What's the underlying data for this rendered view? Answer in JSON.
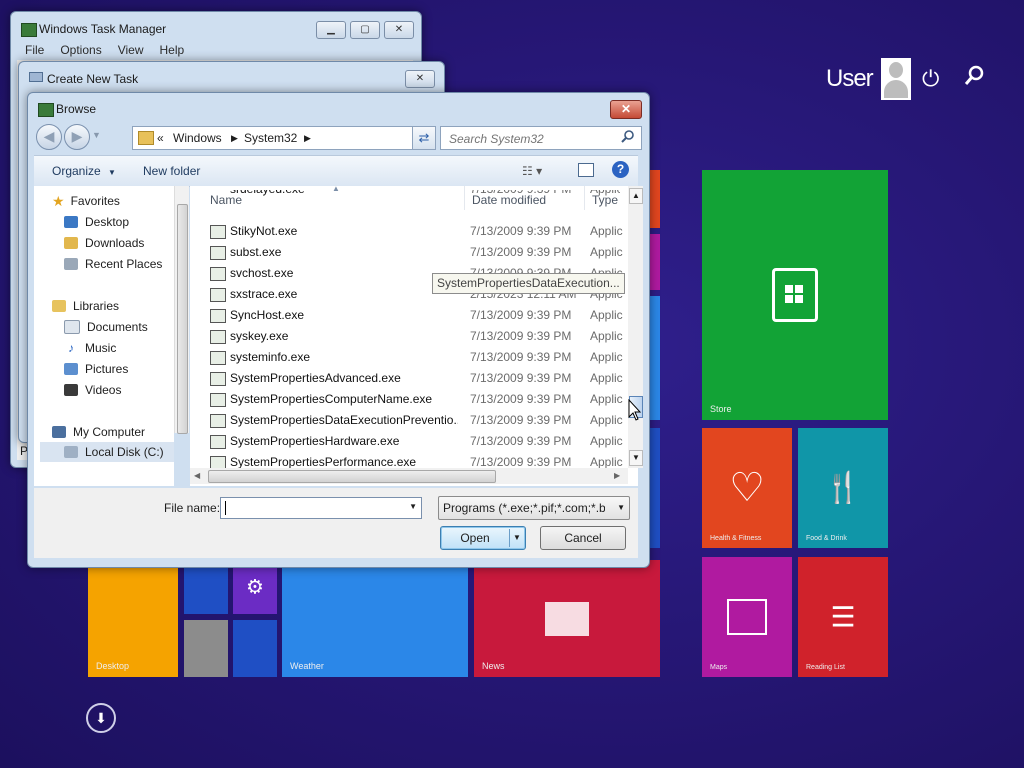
{
  "colors": {
    "desktop": "#241779",
    "tile_green": "#12a336",
    "tile_orange": "#e2461f",
    "tile_teal": "#1096a8",
    "tile_purple": "#b01aa0",
    "tile_red": "#c8193c",
    "tile_crimson": "#d0222b",
    "tile_yellow": "#f5a300",
    "tile_blue": "#2b87e8",
    "tile_small_purple": "#6b2cc4",
    "tile_dark_blue": "#1f4fc4",
    "tile_gray": "#8c8c8c"
  },
  "start_screen": {
    "user_name": "User",
    "icons": [
      "power-icon",
      "search-icon",
      "down-arrow-icon"
    ],
    "tiles": [
      {
        "id": "store",
        "label": "Store",
        "icon": "shopping-bag-icon"
      },
      {
        "id": "health",
        "label": "Health & Fitness",
        "icon": "heart-icon"
      },
      {
        "id": "food",
        "label": "Food & Drink",
        "icon": "fork-knife-icon"
      },
      {
        "id": "maps",
        "label": "Maps",
        "icon": "map-icon"
      },
      {
        "id": "reading",
        "label": "Reading List",
        "icon": "list-icon"
      },
      {
        "id": "news",
        "label": "News",
        "icon": "newspaper-icon"
      },
      {
        "id": "weather",
        "label": "Weather",
        "icon": "weather-icon"
      },
      {
        "id": "desktop",
        "label": "Desktop",
        "icon": "desktop-icon"
      }
    ]
  },
  "task_manager": {
    "title": "Windows Task Manager",
    "menu": [
      "File",
      "Options",
      "View",
      "Help"
    ],
    "side_letter": "P"
  },
  "create_task": {
    "title": "Create New Task"
  },
  "browse": {
    "title": "Browse",
    "address": {
      "prefix": "«",
      "crumbs": [
        "Windows",
        "System32"
      ]
    },
    "search_placeholder": "Search System32",
    "toolbar": {
      "organize": "Organize",
      "new_folder": "New folder"
    },
    "nav": {
      "favorites_header": "Favorites",
      "favorites": [
        "Desktop",
        "Downloads",
        "Recent Places"
      ],
      "libraries_header": "Libraries",
      "libraries": [
        "Documents",
        "Music",
        "Pictures",
        "Videos"
      ],
      "computer_header": "My Computer",
      "computer": [
        "Local Disk (C:)"
      ]
    },
    "columns": {
      "name": "Name",
      "date": "Date modified",
      "type": "Type"
    },
    "files": [
      {
        "name": "srdelayed.exe",
        "date": "7/13/2009 9:39 PM",
        "type": "Applic"
      },
      {
        "name": "StikyNot.exe",
        "date": "7/13/2009 9:39 PM",
        "type": "Applic"
      },
      {
        "name": "subst.exe",
        "date": "7/13/2009 9:39 PM",
        "type": "Applic"
      },
      {
        "name": "svchost.exe",
        "date": "7/13/2009 9:39 PM",
        "type": "Applic"
      },
      {
        "name": "sxstrace.exe",
        "date": "2/15/2023 12:11 AM",
        "type": "Applic"
      },
      {
        "name": "SyncHost.exe",
        "date": "7/13/2009 9:39 PM",
        "type": "Applic"
      },
      {
        "name": "syskey.exe",
        "date": "7/13/2009 9:39 PM",
        "type": "Applic"
      },
      {
        "name": "systeminfo.exe",
        "date": "7/13/2009 9:39 PM",
        "type": "Applic"
      },
      {
        "name": "SystemPropertiesAdvanced.exe",
        "date": "7/13/2009 9:39 PM",
        "type": "Applic"
      },
      {
        "name": "SystemPropertiesComputerName.exe",
        "date": "7/13/2009 9:39 PM",
        "type": "Applic"
      },
      {
        "name": "SystemPropertiesDataExecutionPreventio...",
        "date": "7/13/2009 9:39 PM",
        "type": "Applic"
      },
      {
        "name": "SystemPropertiesHardware.exe",
        "date": "7/13/2009 9:39 PM",
        "type": "Applic"
      },
      {
        "name": "SystemPropertiesPerformance.exe",
        "date": "7/13/2009 9:39 PM",
        "type": "Applic"
      }
    ],
    "tooltip": "SystemPropertiesDataExecution...",
    "file_name_label": "File name:",
    "file_name_value": "",
    "filter": "Programs (*.exe;*.pif;*.com;*.ba",
    "open": "Open",
    "cancel": "Cancel"
  }
}
